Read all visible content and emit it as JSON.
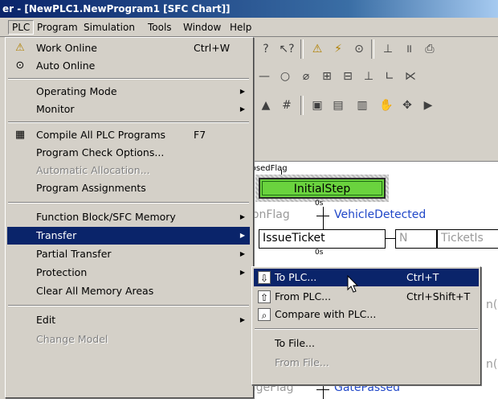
{
  "window": {
    "title": "er - [NewPLC1.NewProgram1 [SFC Chart]]"
  },
  "menubar": [
    "PLC",
    "Program",
    "Simulation",
    "Tools",
    "Window",
    "Help"
  ],
  "plc_menu": {
    "work_online": {
      "label": "Work Online",
      "shortcut": "Ctrl+W"
    },
    "auto_online": "Auto Online",
    "operating_mode": "Operating Mode",
    "monitor": "Monitor",
    "compile_all": {
      "label": "Compile All PLC Programs",
      "shortcut": "F7"
    },
    "program_check_options": "Program Check Options...",
    "automatic_allocation": "Automatic Allocation...",
    "program_assignments": "Program Assignments",
    "function_block_memory": "Function Block/SFC Memory",
    "transfer": "Transfer",
    "partial_transfer": "Partial Transfer",
    "protection": "Protection",
    "clear_all_memory": "Clear All Memory Areas",
    "edit": "Edit",
    "change_model": "Change Model"
  },
  "transfer_submenu": {
    "to_plc": {
      "label": "To PLC...",
      "shortcut": "Ctrl+T"
    },
    "from_plc": {
      "label": "From PLC...",
      "shortcut": "Ctrl+Shift+T"
    },
    "compare_with_plc": "Compare with PLC...",
    "to_file": "To File...",
    "from_file": "From File..."
  },
  "sfc_chart": {
    "closed_flag": "losedFlag",
    "initial_step": "InitialStep",
    "zero_s_1": "0s",
    "condition_flag": "ionFlag",
    "vehicle_detected": "VehicleDetected",
    "issue_ticket": "IssueTicket",
    "qualifier": "N",
    "ticket_action": "TicketIs",
    "zero_s_2": "0s",
    "gate_flag": "ageFlag",
    "gate_passed": "GatePassed",
    "right_fragment_1": "n(",
    "right_fragment_2": "n("
  },
  "colors": {
    "highlight": "#0a246a",
    "step_green": "#6ad33e",
    "link_blue": "#2047c8"
  }
}
